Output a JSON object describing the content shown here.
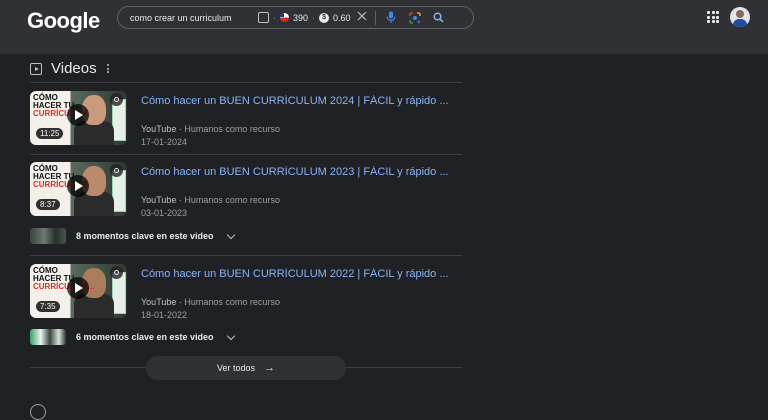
{
  "header": {
    "logo": "Google",
    "search": {
      "query": "como crear un curriculum",
      "ext_value_1": "390",
      "ext_value_2": "0.60",
      "coin_symbol": "$"
    }
  },
  "section": {
    "title": "Videos"
  },
  "videos": [
    {
      "title": "Cómo hacer un BUEN CURRÍCULUM 2024 | FÁCIL y rápido ...",
      "source": "YouTube",
      "channel": "Humanos como recurso",
      "date": "17-01-2024",
      "duration": "11:25",
      "thumb_line1": "CÓMO",
      "thumb_line2": "HACER TU",
      "thumb_line3": "CURRÍCULUM"
    },
    {
      "title": "Cómo hacer un BUEN CURRÍCULUM 2023 | FÁCIL y rápido ...",
      "source": "YouTube",
      "channel": "Humanos como recurso",
      "date": "03-01-2023",
      "duration": "8:37",
      "thumb_line1": "CÓMO",
      "thumb_line2": "HACER TU",
      "thumb_line3": "CURRÍCULUM",
      "moments": "8 momentos clave en este video"
    },
    {
      "title": "Cómo hacer un BUEN CURRÍCULUM 2022 | FÁCIL y rápido ...",
      "source": "YouTube",
      "channel": "Humanos como recurso",
      "date": "18-01-2022",
      "duration": "7:35",
      "thumb_line1": "CÓMO",
      "thumb_line2": "HACER TU",
      "thumb_line3": "CURRÍCULUM...",
      "moments": "6 momentos clave en este video"
    }
  ],
  "view_all": {
    "label": "Ver todos",
    "arrow": "→"
  },
  "separator": "·",
  "colors": {
    "background": "#202124",
    "header": "#303134",
    "link": "#8ab4f8",
    "text": "#e8eaed",
    "muted": "#9aa0a6"
  }
}
